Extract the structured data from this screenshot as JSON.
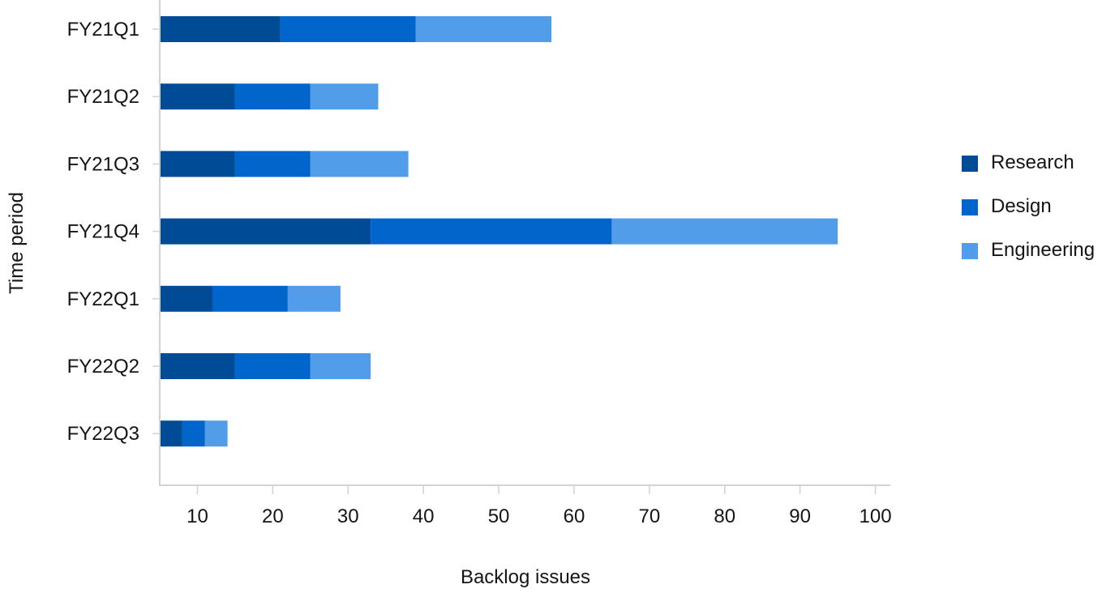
{
  "chart_data": {
    "type": "bar",
    "orientation": "horizontal",
    "stacked": true,
    "title": "",
    "xlabel": "Backlog issues",
    "ylabel": "Time period",
    "categories": [
      "FY21Q1",
      "FY21Q2",
      "FY21Q3",
      "FY21Q4",
      "FY22Q1",
      "FY22Q2",
      "FY22Q3"
    ],
    "series": [
      {
        "name": "Research",
        "color": "#004B95",
        "values": [
          21,
          15,
          15,
          33,
          12,
          15,
          8
        ]
      },
      {
        "name": "Design",
        "color": "#0066CC",
        "values": [
          18,
          10,
          10,
          32,
          10,
          10,
          3
        ]
      },
      {
        "name": "Engineering",
        "color": "#519DE9",
        "values": [
          18,
          9,
          13,
          30,
          7,
          8,
          3
        ]
      }
    ],
    "xlim": [
      5,
      102
    ],
    "x_ticks": [
      10,
      20,
      30,
      40,
      50,
      60,
      70,
      80,
      90,
      100
    ],
    "grid": false,
    "legend_position": "right"
  }
}
